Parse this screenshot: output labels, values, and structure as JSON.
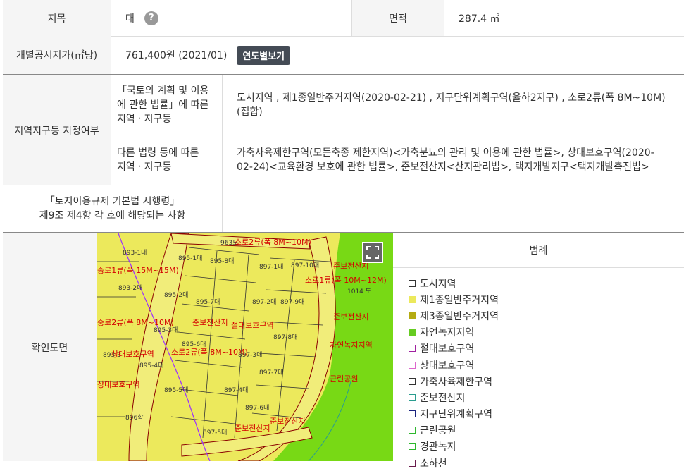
{
  "land_category": {
    "label": "지목",
    "value": "대",
    "help": "?"
  },
  "area": {
    "label": "면적",
    "value": "287.4 ㎡"
  },
  "official_price": {
    "label": "개별공시지가(㎡당)",
    "value": "761,400원 (2021/01)",
    "button": "연도별보기"
  },
  "zoning": {
    "label": "지역지구등 지정여부",
    "national_label": "「국토의 계획 및 이용\n에 관한 법률」에 따른\n지역ㆍ지구등",
    "national_value": "도시지역 , 제1종일반주거지역(2020-02-21) , 지구단위계획구역(율하2지구) , 소로2류(폭 8M~10M)(접합)",
    "other_label": "다른 법령 등에 따른\n지역ㆍ지구등",
    "other_value": "가축사육제한구역(모든축종 제한지역)<가축분뇨의 관리 및 이용에 관한 법률>, 상대보호구역(2020-02-24)<교육환경 보호에 관한 법률>, 준보전산지<산지관리법>, 택지개발지구<택지개발촉진법>"
  },
  "enforcement": {
    "label": "「토지이용규제 기본법 시행령」\n제9조 제4항 각 호에 해당되는 사항",
    "value": ""
  },
  "map_section": {
    "label": "확인도면",
    "map_labels": {
      "road_top": "소로2류(폭 8M~10M)",
      "road_left": "중로2류(폭 8M~10M)",
      "road_mid": "소로2류(폭 8M~10M)",
      "road_right": "소로1류(폭 10M~12M)",
      "road_left2": "중로1류(폭 15M~15M)",
      "zone_a": "준보전산지",
      "zone_b": "준보전산지",
      "zone_c": "준보전산지",
      "zone_d": "준보전산지",
      "zone_e": "준보전산지",
      "green": "자연녹지지역",
      "park": "근린공원",
      "protect": "상대보호구역",
      "protect2": "절대보호구역",
      "protect3": "상대보호구역"
    },
    "parcels": [
      "893-1대",
      "895-1대",
      "895-8대",
      "897-1대",
      "897-10대",
      "893-2대",
      "895-2대",
      "895-7대",
      "897-2대",
      "897-9대",
      "895-3대",
      "895-6대",
      "897-8대",
      "895-4대",
      "897-3대",
      "897-7대",
      "895-5대",
      "897-4대",
      "897-6대",
      "896학",
      "897-5대",
      "1014 도",
      "963도",
      "893-3"
    ]
  },
  "legend": {
    "title": "범례",
    "items": [
      {
        "label": "도시지역",
        "color": "#ffffff",
        "border": "#333333"
      },
      {
        "label": "제1종일반주거지역",
        "color": "#ece95c",
        "border": "#ece95c"
      },
      {
        "label": "제3종일반주거지역",
        "color": "#b5ab12",
        "border": "#b5ab12"
      },
      {
        "label": "자연녹지지역",
        "color": "#66cc22",
        "border": "#66cc22"
      },
      {
        "label": "절대보호구역",
        "color": "#ffffff",
        "border": "#a020a0"
      },
      {
        "label": "상대보호구역",
        "color": "#ffffff",
        "border": "#dd66cc"
      },
      {
        "label": "가축사육제한구역",
        "color": "#ffffff",
        "border": "#333333"
      },
      {
        "label": "준보전산지",
        "color": "#ffffff",
        "border": "#2a9d8f"
      },
      {
        "label": "지구단위계획구역",
        "color": "#ffffff",
        "border": "#1a237e"
      },
      {
        "label": "근린공원",
        "color": "#ffffff",
        "border": "#2eb82e"
      },
      {
        "label": "경관녹지",
        "color": "#ffffff",
        "border": "#2eb82e"
      },
      {
        "label": "소하천",
        "color": "#ffffff",
        "border": "#6a1b4d"
      }
    ]
  },
  "colors": {
    "res1": "#ece95c",
    "green": "#78d915",
    "road_text": "#d40000"
  }
}
